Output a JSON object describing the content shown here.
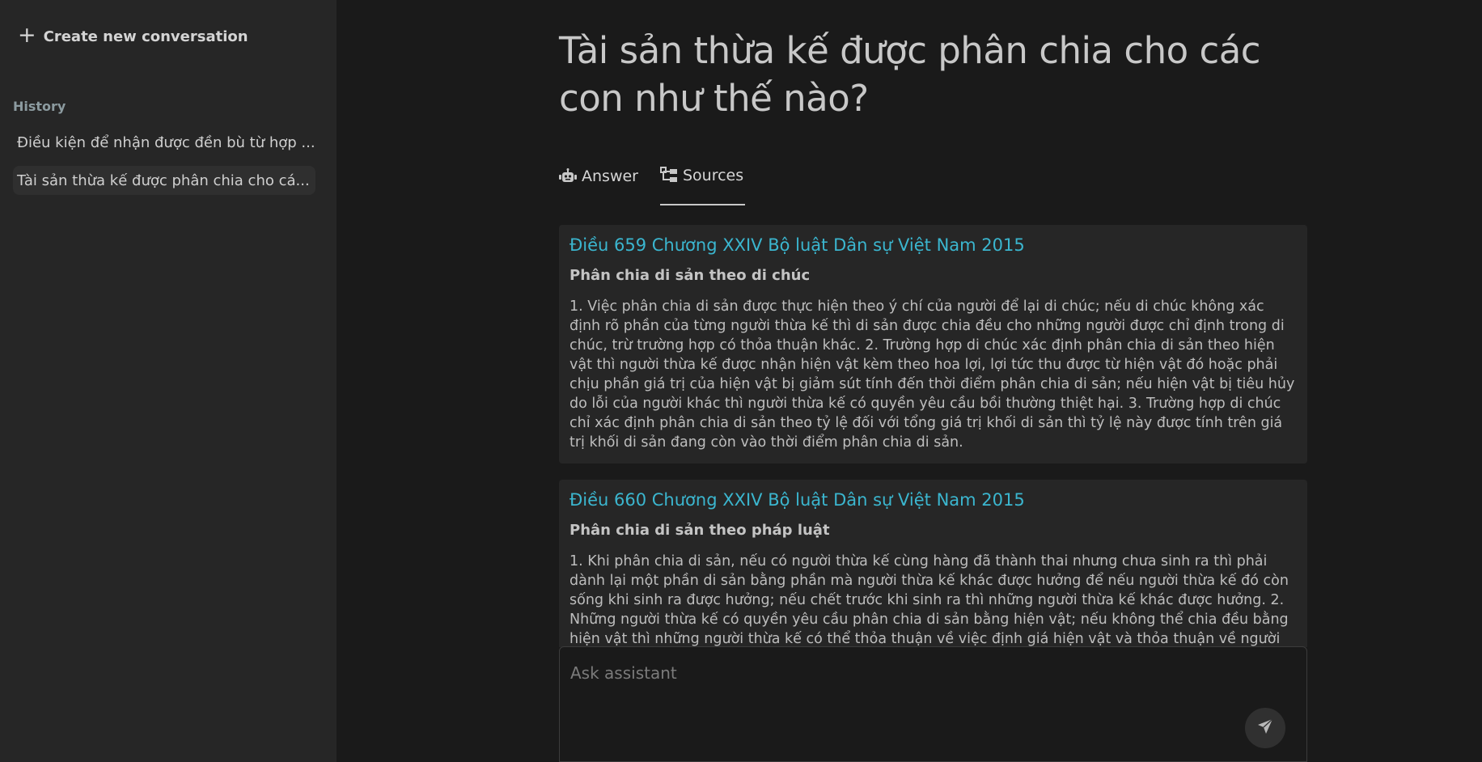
{
  "sidebar": {
    "new_conversation_label": "Create new conversation",
    "history_label": "History",
    "history_items": [
      {
        "label": "Điều kiện để nhận được đền bù từ hợp ..."
      },
      {
        "label": "Tài sản thừa kế được phân chia cho cá..."
      }
    ]
  },
  "main": {
    "question": "Tài sản thừa kế được phân chia cho các con như thế nào?",
    "tabs": [
      {
        "label": "Answer",
        "icon": "robot-icon"
      },
      {
        "label": "Sources",
        "icon": "sitemap-icon"
      }
    ],
    "active_tab": "Sources",
    "sources": [
      {
        "title": "Điều 659 Chương XXIV Bộ luật Dân sự Việt Nam 2015",
        "subtitle": "Phân chia di sản theo di chúc",
        "text": "1. Việc phân chia di sản được thực hiện theo ý chí của người để lại di chúc; nếu di chúc không xác định rõ phần của từng người thừa kế thì di sản được chia đều cho những người được chỉ định trong di chúc, trừ trường hợp có thỏa thuận khác. 2. Trường hợp di chúc xác định phân chia di sản theo hiện vật thì người thừa kế được nhận hiện vật kèm theo hoa lợi, lợi tức thu được từ hiện vật đó hoặc phải chịu phần giá trị của hiện vật bị giảm sút tính đến thời điểm phân chia di sản; nếu hiện vật bị tiêu hủy do lỗi của người khác thì người thừa kế có quyền yêu cầu bồi thường thiệt hại. 3. Trường hợp di chúc chỉ xác định phân chia di sản theo tỷ lệ đối với tổng giá trị khối di sản thì tỷ lệ này được tính trên giá trị khối di sản đang còn vào thời điểm phân chia di sản."
      },
      {
        "title": "Điều 660 Chương XXIV Bộ luật Dân sự Việt Nam 2015",
        "subtitle": "Phân chia di sản theo pháp luật",
        "text": "1. Khi phân chia di sản, nếu có người thừa kế cùng hàng đã thành thai nhưng chưa sinh ra thì phải dành lại một phần di sản bằng phần mà người thừa kế khác được hưởng để nếu người thừa kế đó còn sống khi sinh ra được hưởng; nếu chết trước khi sinh ra thì những người thừa kế khác được hưởng. 2. Những người thừa kế có quyền yêu cầu phân chia di sản bằng hiện vật; nếu không thể chia đều bằng hiện vật thì những người thừa kế có thể thỏa thuận về việc định giá hiện vật và thỏa thuận về người nhận hiện"
      }
    ]
  },
  "composer": {
    "placeholder": "Ask assistant",
    "value": "",
    "send_icon": "send-icon"
  },
  "colors": {
    "background": "#1a1a1a",
    "sidebar": "#262626",
    "card": "#262626",
    "accent_link": "#3bb6cf"
  }
}
